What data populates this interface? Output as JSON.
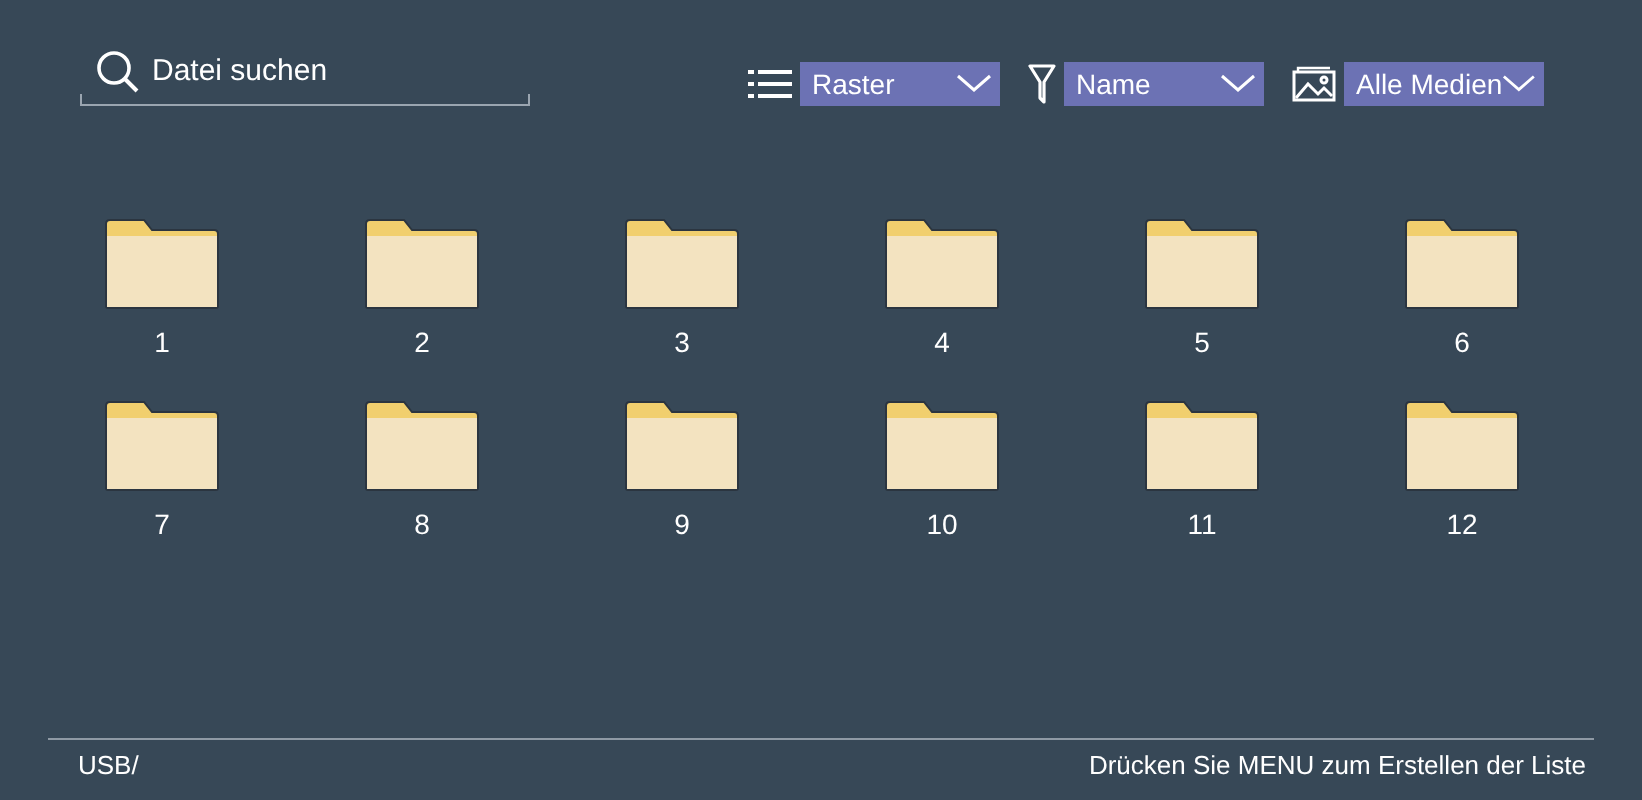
{
  "search": {
    "placeholder": "Datei suchen"
  },
  "toolbar": [
    {
      "kind": "view",
      "value": "Raster"
    },
    {
      "kind": "sort",
      "value": "Name"
    },
    {
      "kind": "media",
      "value": "Alle Medien"
    }
  ],
  "folders": [
    {
      "name": "1"
    },
    {
      "name": "2"
    },
    {
      "name": "3"
    },
    {
      "name": "4"
    },
    {
      "name": "5"
    },
    {
      "name": "6"
    },
    {
      "name": "7"
    },
    {
      "name": "8"
    },
    {
      "name": "9"
    },
    {
      "name": "10"
    },
    {
      "name": "11"
    },
    {
      "name": "12"
    }
  ],
  "status_bar": {
    "path": "USB/",
    "hint": "Drücken Sie MENU zum Erstellen der Liste"
  }
}
